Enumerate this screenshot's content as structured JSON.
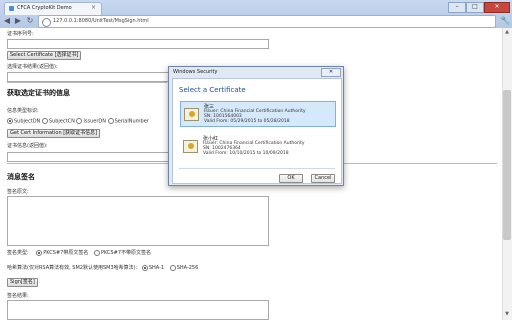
{
  "browser": {
    "tab_title": "CFCA CryptoKit Demo",
    "url": "127.0.0.1:8080/UnitTest/MsgSign.html"
  },
  "page": {
    "cert_sn_label": "证书序列号:",
    "select_cert_button": "Select Certificate [选择证书]",
    "select_result_label": "选择证书结果(返回值):",
    "section_cert_info_heading": "获取选定证书的信息",
    "info_type_label": "信息类型标识:",
    "info_types": [
      "SubjectDN",
      "SubjectCN",
      "IssuerDN",
      "SerialNumber"
    ],
    "get_cert_info_button": "Get Cert Information [获取证书信息]",
    "cert_info_label": "证书信息(返回值):",
    "section_sign_heading": "消息签名",
    "sign_source_label": "签名原文:",
    "sign_type_label": "签名类型:",
    "sign_types": [
      "PKCS#7带原文签名",
      "PKCS#7不带原文签名"
    ],
    "hash_algo_label": "哈希算法(仅对RSA算法有效, SM2默认使用SM3哈希算法):",
    "hash_algos": [
      "SHA-1",
      "SHA-256"
    ],
    "sign_button": "Sign[签名]",
    "sign_result_label": "签名结果:"
  },
  "dialog": {
    "window_title": "Windows Security",
    "close_label": "✕",
    "heading": "Select a Certificate",
    "certs": [
      {
        "name": "张三",
        "issuer": "Issuer: China Financial Certification Authority",
        "sn": "SN: 1001564003",
        "valid": "Valid From: 05/29/2015 to 05/28/2018"
      },
      {
        "name": "张小红",
        "issuer": "Issuer: China Financial Certification Authority",
        "sn": "SN: 1002476364",
        "valid": "Valid From: 10/10/2015 to 10/09/2018"
      }
    ],
    "ok_label": "OK",
    "cancel_label": "Cancel"
  },
  "colors": {
    "dialog_heading": "#1e4e9a",
    "selected_cert_bg": "#d6e8fb"
  }
}
